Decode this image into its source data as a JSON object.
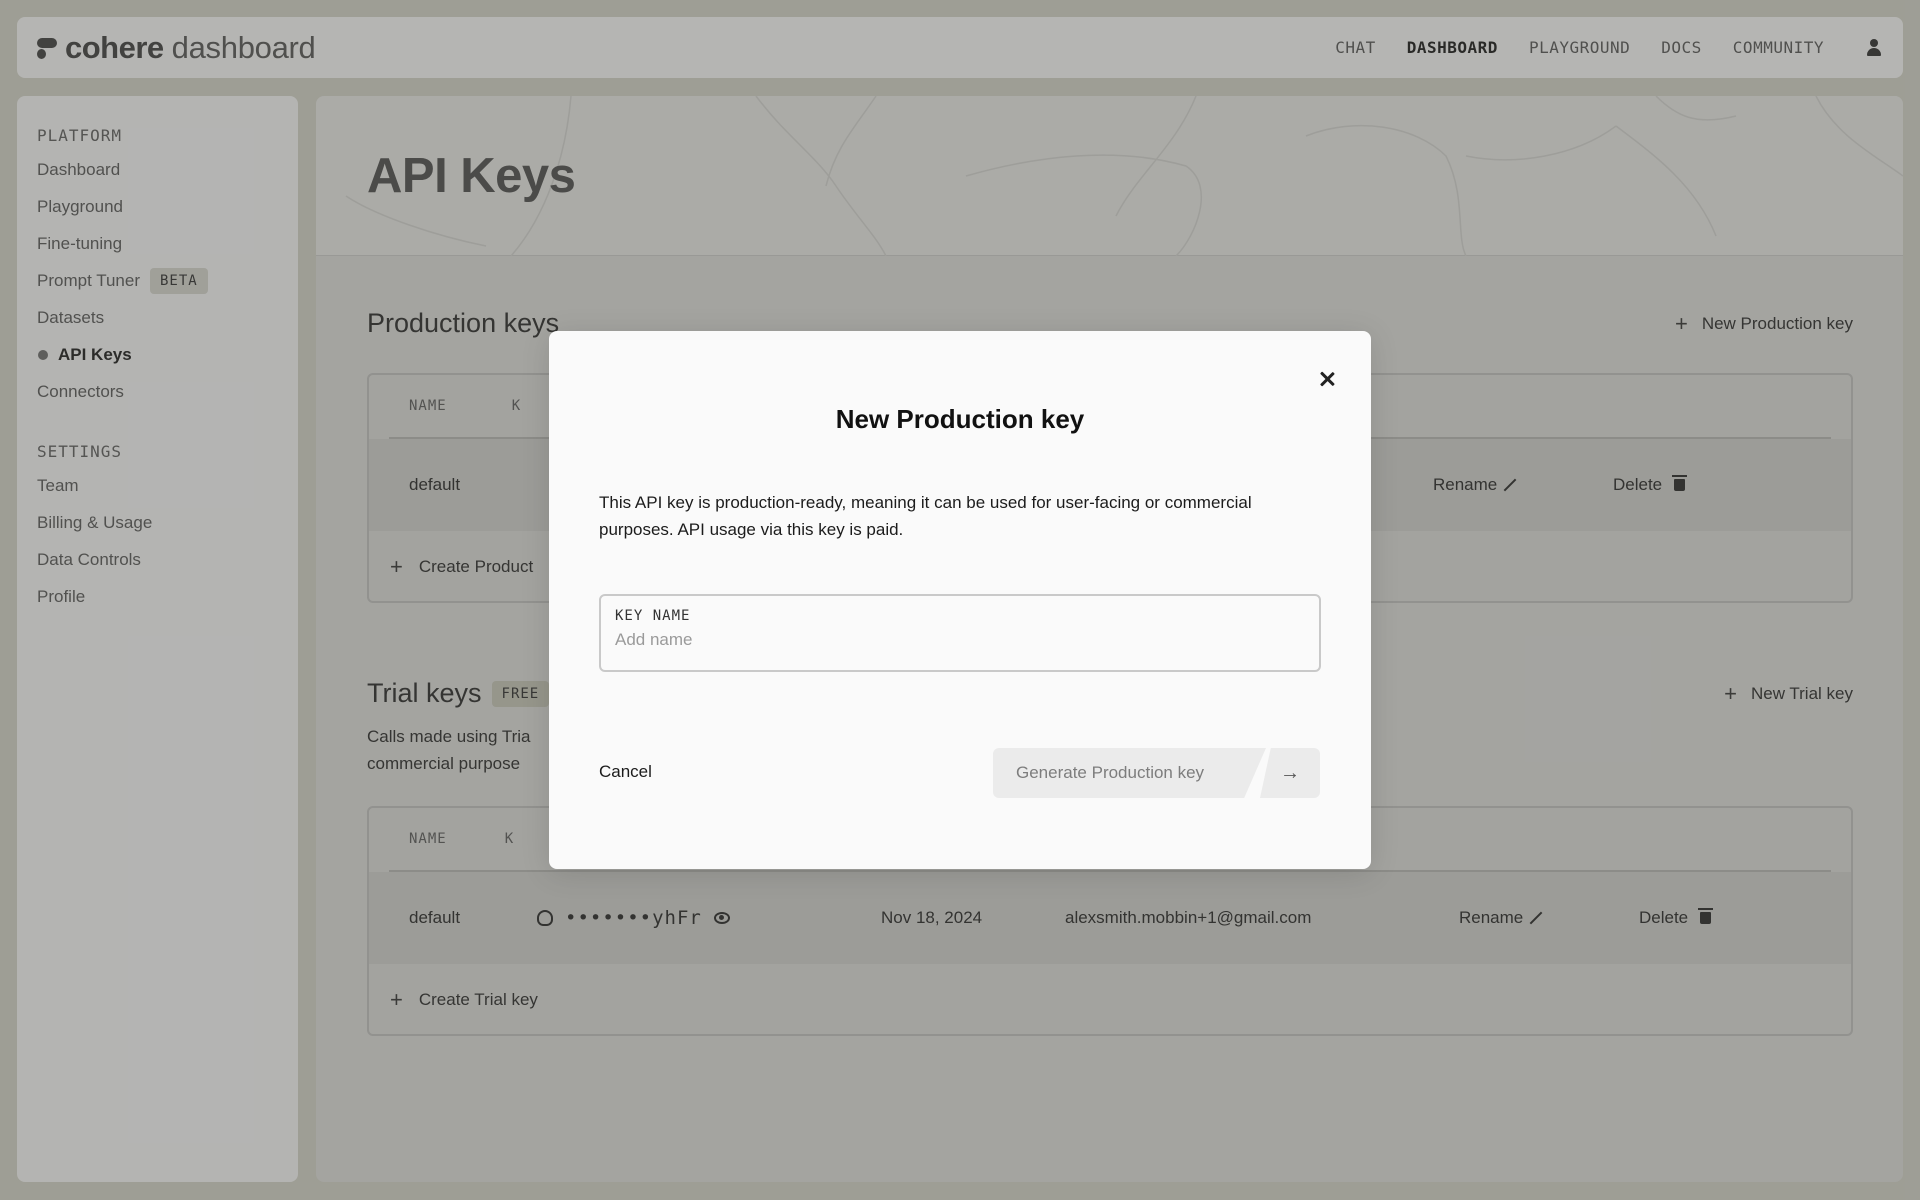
{
  "brand": {
    "name": "cohere",
    "product": "dashboard"
  },
  "nav": {
    "items": [
      {
        "label": "CHAT",
        "active": false
      },
      {
        "label": "DASHBOARD",
        "active": true
      },
      {
        "label": "PLAYGROUND",
        "active": false
      },
      {
        "label": "DOCS",
        "active": false
      },
      {
        "label": "COMMUNITY",
        "active": false
      }
    ]
  },
  "sidebar": {
    "platform_heading": "PLATFORM",
    "platform_items": [
      "Dashboard",
      "Playground",
      "Fine-tuning",
      "Prompt Tuner",
      "Datasets",
      "API Keys",
      "Connectors"
    ],
    "beta_badge": "BETA",
    "settings_heading": "SETTINGS",
    "settings_items": [
      "Team",
      "Billing & Usage",
      "Data Controls",
      "Profile"
    ]
  },
  "page": {
    "title": "API Keys"
  },
  "production": {
    "title": "Production keys",
    "new_label": "New Production key",
    "col_name": "NAME",
    "col_key_partial": "K",
    "row": {
      "name": "default",
      "rename": "Rename",
      "delete": "Delete"
    },
    "create_label": "Create Product"
  },
  "trial": {
    "title": "Trial keys",
    "badge": "FREE",
    "new_label": "New Trial key",
    "desc_line1": "Calls made using Tria",
    "desc_line2": "commercial purpose",
    "col_name": "NAME",
    "col_key_partial": "K",
    "row": {
      "name": "default",
      "key": "•••••••yhFr",
      "date": "Nov 18, 2024",
      "email": "alexsmith.mobbin+1@gmail.com",
      "rename": "Rename",
      "delete": "Delete"
    },
    "create_label": "Create Trial key"
  },
  "modal": {
    "title": "New Production key",
    "description": "This API key is production-ready, meaning it can be used for user-facing or commercial purposes. API usage via this key is paid.",
    "field_label": "KEY NAME",
    "field_placeholder": "Add name",
    "field_value": "",
    "cancel": "Cancel",
    "generate": "Generate Production key",
    "arrow": "→"
  },
  "icons": {
    "close": "close-icon",
    "plus": "plus-icon",
    "eye": "eye-icon",
    "pencil": "pencil-icon",
    "trash": "trash-icon",
    "user": "user-icon",
    "arrow": "arrow-right-icon"
  }
}
